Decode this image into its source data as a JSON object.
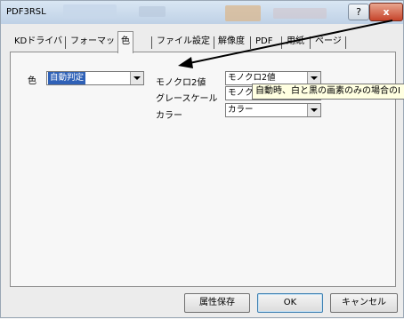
{
  "window": {
    "title": "PDF3RSL",
    "help_label": "?",
    "close_label": "x"
  },
  "tabs": [
    {
      "label": "KDドライバ"
    },
    {
      "label": "フォーマット"
    },
    {
      "label": "色",
      "active": true
    },
    {
      "label": "ファイル設定"
    },
    {
      "label": "解像度"
    },
    {
      "label": "PDF"
    },
    {
      "label": "用紙"
    },
    {
      "label": "ページ"
    }
  ],
  "color_section": {
    "label": "色",
    "value": "自動判定",
    "mono_label": "モノクロ2値",
    "mono_value": "モノクロ2値",
    "gray_label": "グレースケール",
    "gray_value": "モノクロ",
    "color_label": "カラー",
    "color_value": "カラー"
  },
  "tooltip": {
    "text": "自動時、白と黒の画素のみの場合のI"
  },
  "buttons": {
    "save_attr": "属性保存",
    "ok": "OK",
    "cancel": "キャンセル"
  },
  "colors": {
    "selection": "#2f61b7",
    "arrow": "#000000",
    "tooltip_bg": "#ffffe1",
    "close_button": "#c6442b"
  }
}
